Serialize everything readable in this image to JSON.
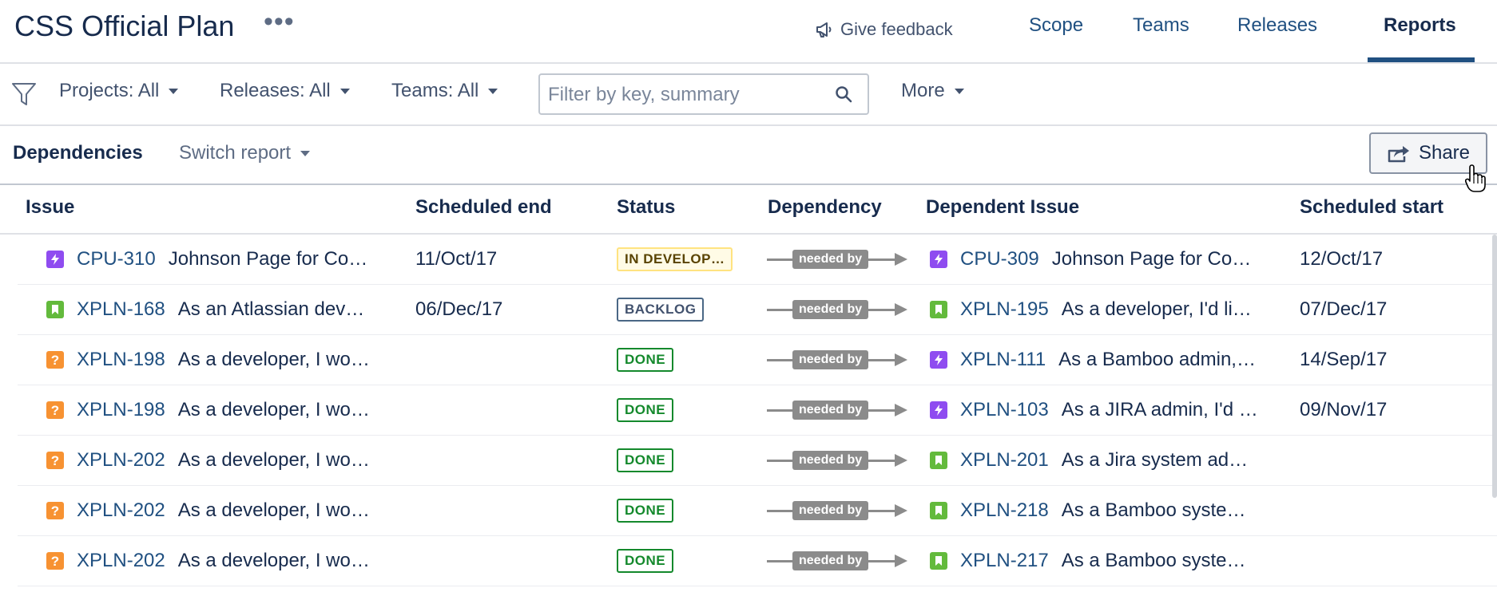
{
  "header": {
    "plan_title": "CSS Official Plan",
    "more_menu": "•••",
    "feedback": "Give feedback",
    "tabs": [
      {
        "label": "Scope"
      },
      {
        "label": "Teams"
      },
      {
        "label": "Releases"
      },
      {
        "label": "Reports",
        "active": true
      }
    ]
  },
  "filters": {
    "projects": "Projects: All",
    "releases": "Releases: All",
    "teams": "Teams: All",
    "search_placeholder": "Filter by key, summary",
    "more": "More"
  },
  "report": {
    "name": "Dependencies",
    "switch_label": "Switch report",
    "share_label": "Share"
  },
  "table": {
    "columns": {
      "issue": "Issue",
      "scheduled_end": "Scheduled end",
      "status": "Status",
      "dependency": "Dependency",
      "dependent_issue": "Dependent Issue",
      "scheduled_start": "Scheduled start"
    },
    "rows": [
      {
        "issue_type": "epic",
        "issue_key": "CPU-310",
        "issue_summary": "Johnson Page for Co…",
        "scheduled_end": "11/Oct/17",
        "status": "IN DEVELOP…",
        "status_kind": "dev",
        "dependency": "needed by",
        "dep_type": "epic",
        "dep_key": "CPU-309",
        "dep_summary": "Johnson Page for Co…",
        "scheduled_start": "12/Oct/17"
      },
      {
        "issue_type": "story",
        "issue_key": "XPLN-168",
        "issue_summary": "As an Atlassian dev…",
        "scheduled_end": "06/Dec/17",
        "status": "BACKLOG",
        "status_kind": "backlog",
        "dependency": "needed by",
        "dep_type": "story",
        "dep_key": "XPLN-195",
        "dep_summary": "As a developer, I'd li…",
        "scheduled_start": "07/Dec/17"
      },
      {
        "issue_type": "question",
        "issue_key": "XPLN-198",
        "issue_summary": "As a developer, I wo…",
        "scheduled_end": "",
        "status": "DONE",
        "status_kind": "done",
        "dependency": "needed by",
        "dep_type": "epic",
        "dep_key": "XPLN-111",
        "dep_summary": "As a Bamboo admin,…",
        "scheduled_start": "14/Sep/17"
      },
      {
        "issue_type": "question",
        "issue_key": "XPLN-198",
        "issue_summary": "As a developer, I wo…",
        "scheduled_end": "",
        "status": "DONE",
        "status_kind": "done",
        "dependency": "needed by",
        "dep_type": "epic",
        "dep_key": "XPLN-103",
        "dep_summary": "As a JIRA admin, I'd …",
        "scheduled_start": "09/Nov/17"
      },
      {
        "issue_type": "question",
        "issue_key": "XPLN-202",
        "issue_summary": "As a developer, I wo…",
        "scheduled_end": "",
        "status": "DONE",
        "status_kind": "done",
        "dependency": "needed by",
        "dep_type": "story",
        "dep_key": "XPLN-201",
        "dep_summary": "As a Jira system ad…",
        "scheduled_start": ""
      },
      {
        "issue_type": "question",
        "issue_key": "XPLN-202",
        "issue_summary": "As a developer, I wo…",
        "scheduled_end": "",
        "status": "DONE",
        "status_kind": "done",
        "dependency": "needed by",
        "dep_type": "story",
        "dep_key": "XPLN-218",
        "dep_summary": "As a Bamboo syste…",
        "scheduled_start": ""
      },
      {
        "issue_type": "question",
        "issue_key": "XPLN-202",
        "issue_summary": "As a developer, I wo…",
        "scheduled_end": "",
        "status": "DONE",
        "status_kind": "done",
        "dependency": "needed by",
        "dep_type": "story",
        "dep_key": "XPLN-217",
        "dep_summary": "As a Bamboo syste…",
        "scheduled_start": ""
      }
    ]
  },
  "colors": {
    "link": "#205081",
    "epic": "#8f4cf0",
    "story": "#63ba3c",
    "question": "#f79232",
    "done": "#14892c",
    "dependency_gray": "#8b8b8b"
  },
  "icons": {
    "more": "more-dots-icon",
    "feedback": "megaphone-icon",
    "filter": "filter-funnel-icon",
    "search": "search-icon",
    "share": "share-icon",
    "epic": "lightning-epic-icon",
    "story": "bookmark-story-icon",
    "question": "question-icon",
    "cursor": "hand-pointer-icon"
  }
}
